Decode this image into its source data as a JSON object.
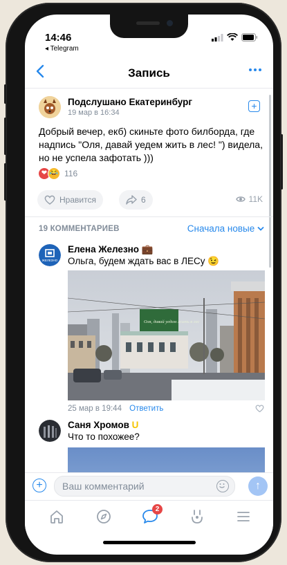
{
  "status": {
    "time": "14:46",
    "back_app": "◂ Telegram"
  },
  "nav": {
    "back_icon": "chevron-left-icon",
    "title": "Запись",
    "more_icon": "more-horizontal-icon"
  },
  "post": {
    "group_name": "Подслушано Екатеринбург",
    "date": "19 мар в 16:34",
    "text": "Добрый вечер, екб) скиньте фото билборда, где надпись \"Оля, давай уедем жить в лес! \") видела, но не успела зафотать )))",
    "reactions_count": "116",
    "like_label": "Нравится",
    "share_count": "6",
    "views": "11K"
  },
  "comments_section": {
    "count_label": "19 КОММЕНТАРИЕВ",
    "sort_label": "Сначала новые"
  },
  "comments": [
    {
      "author": "Елена Железно",
      "author_emoji": "💼",
      "text": "Ольга, будем ждать вас в ЛЕСу",
      "text_emoji": "😉",
      "avatar_text": "ЖЕЛЕЗНО",
      "billboard_text": "Оля, давай уедем жить в лес",
      "date": "25 мар в 19:44",
      "reply_label": "Ответить"
    },
    {
      "author": "Саня Хромов",
      "author_emoji": "U",
      "text": "Что то похожее?"
    }
  ],
  "input": {
    "placeholder": "Ваш комментарий"
  },
  "tabbar": {
    "items": [
      "home-icon",
      "explore-icon",
      "messages-icon",
      "clips-icon",
      "menu-icon"
    ],
    "messages_badge": "2"
  },
  "colors": {
    "accent": "#2688eb",
    "secondary_text": "#818c99",
    "badge": "#e64646"
  }
}
